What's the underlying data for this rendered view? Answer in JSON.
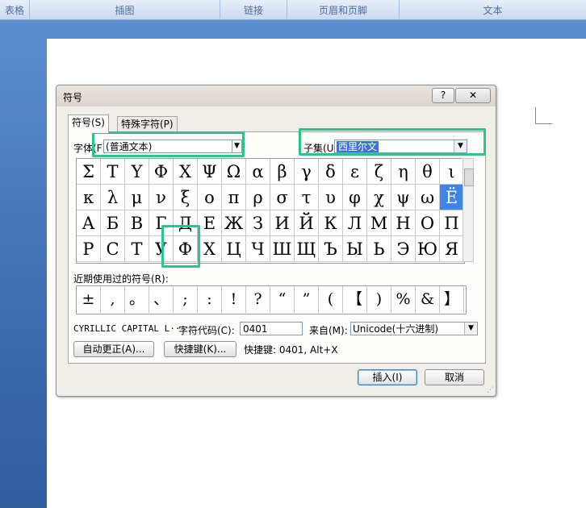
{
  "ribbon": {
    "groups": [
      "表格",
      "插图",
      "链接",
      "页眉和页脚",
      "文本"
    ]
  },
  "dialog": {
    "title": "符号",
    "help_label": "?",
    "close_label": "✕",
    "tabs": [
      "符号(S)",
      "特殊字符(P)"
    ],
    "font_label": "字体(F):",
    "font_value": "(普通文本)",
    "subset_label": "子集(U):",
    "subset_value": "西里尔文",
    "symbol_grid": [
      [
        "Σ",
        "Τ",
        "Υ",
        "Φ",
        "Χ",
        "Ψ",
        "Ω",
        "α",
        "β",
        "γ",
        "δ",
        "ε",
        "ζ",
        "η",
        "θ",
        "ι"
      ],
      [
        "κ",
        "λ",
        "μ",
        "ν",
        "ξ",
        "ο",
        "π",
        "ρ",
        "σ",
        "τ",
        "υ",
        "φ",
        "χ",
        "ψ",
        "ω",
        "Ё"
      ],
      [
        "А",
        "Б",
        "В",
        "Г",
        "Д",
        "Е",
        "Ж",
        "З",
        "И",
        "Й",
        "К",
        "Л",
        "М",
        "Н",
        "О",
        "П"
      ],
      [
        "Р",
        "С",
        "Т",
        "У",
        "Ф",
        "Х",
        "Ц",
        "Ч",
        "Ш",
        "Щ",
        "Ъ",
        "Ы",
        "Ь",
        "Э",
        "Ю",
        "Я"
      ]
    ],
    "selected_symbol": "Ё",
    "recent_label": "近期使用过的符号(R):",
    "recent_symbols": [
      "±",
      ",",
      "。",
      "、",
      ";",
      ":",
      "!",
      "?",
      "“",
      "”",
      "(",
      "【",
      ")",
      "%",
      "&",
      "】"
    ],
    "char_name": "CYRILLIC CAPITAL L···",
    "charcode_label": "字符代码(C):",
    "charcode_value": "0401",
    "from_label": "来自(M):",
    "from_value": "Unicode(十六进制)",
    "autocorrect_button": "自动更正(A)...",
    "shortcut_key_button": "快捷键(K)...",
    "shortcut_text": "快捷键: 0401, Alt+X",
    "insert_button": "插入(I)",
    "cancel_button": "取消"
  },
  "highlight_color": "#2bc48a",
  "selection_color": "#3d86e6"
}
